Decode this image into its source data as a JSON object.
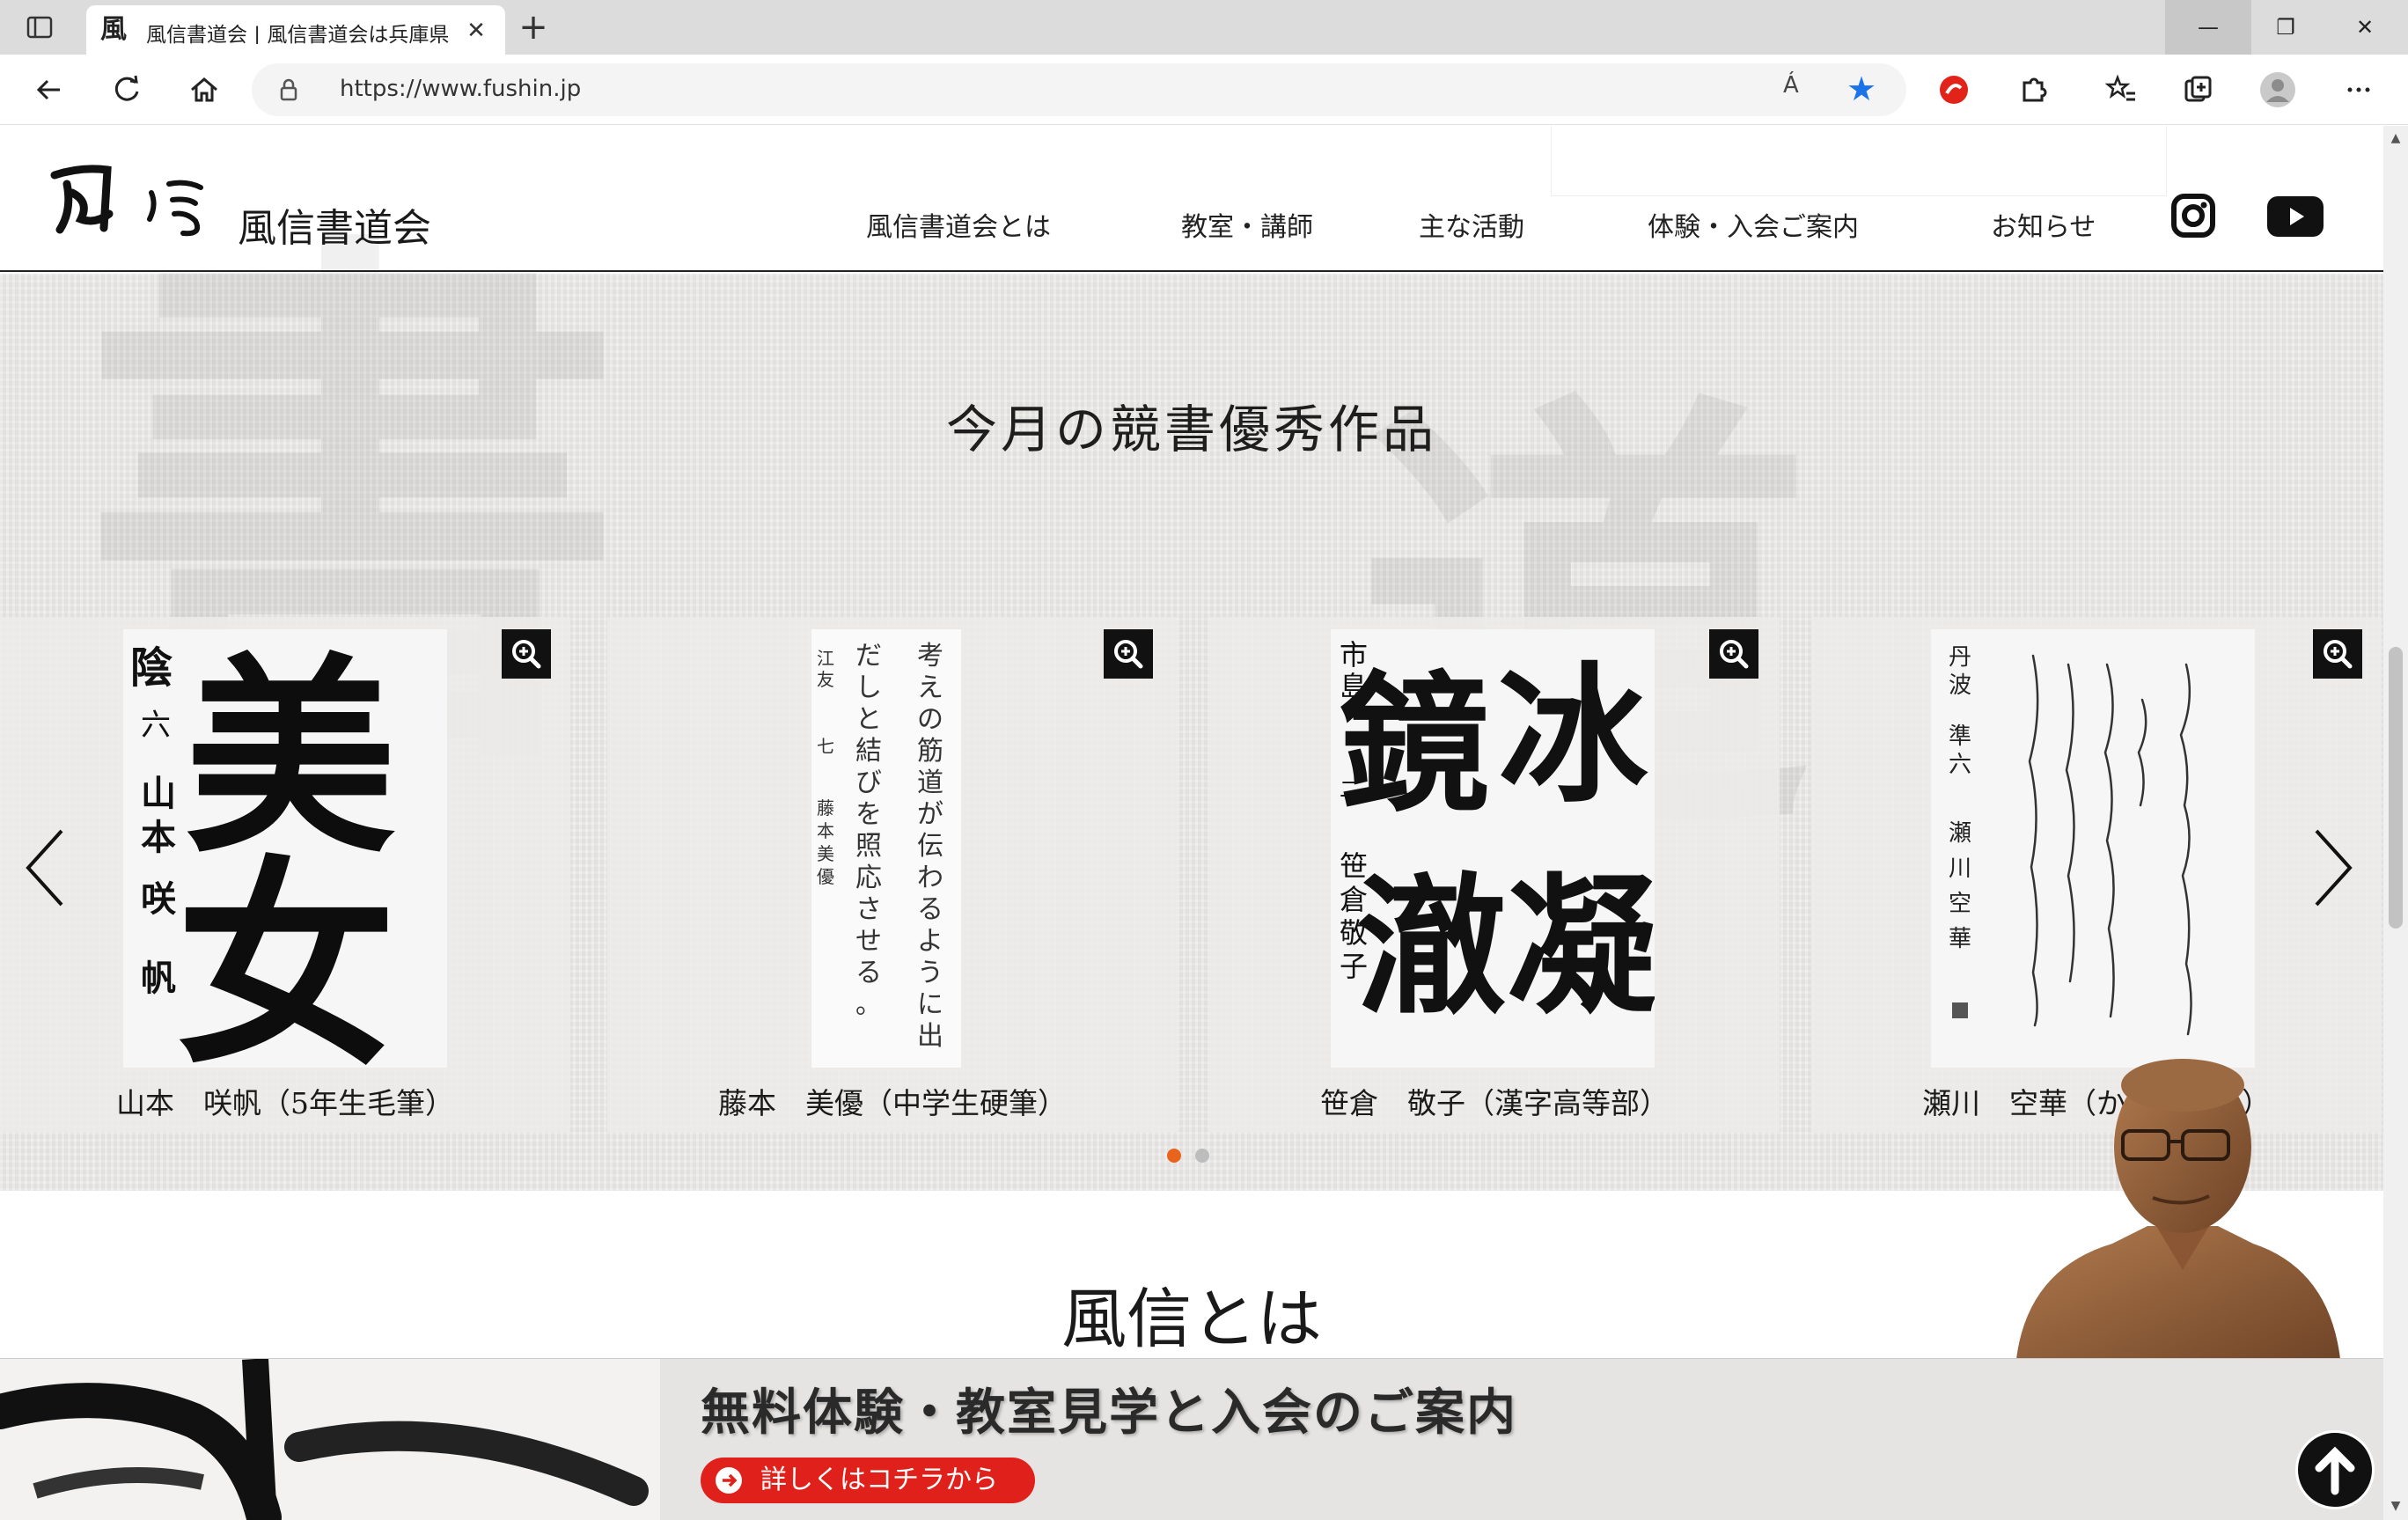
{
  "browser": {
    "tab_title": "風信書道会 | 風信書道会は兵庫県",
    "tab_favicon": "風",
    "url": "https://www.fushin.jp",
    "read_aloud": "Á"
  },
  "header": {
    "logo_text": "風信書道会",
    "logo_mark": "風 信",
    "nav": [
      "風信書道会とは",
      "教室・講師",
      "主な活動",
      "体験・入会ご案内",
      "お知らせ"
    ],
    "icons": [
      "instagram-icon",
      "youtube-icon"
    ]
  },
  "hero": {
    "title": "今月の競書優秀作品",
    "works": [
      {
        "caption": "山本　咲帆（5年生毛筆）",
        "main": "美女",
        "side": "陰 六 山本 咲帆"
      },
      {
        "caption": "藤本　美優（中学生硬筆）",
        "main": "考えの筋道が伝わるように出だしと結びを照応させる。",
        "side": "江友 七 藤本美優"
      },
      {
        "caption": "笹倉　敬子（漢字高等部）",
        "main": "鏡冰澈凝",
        "side": "市島 二 笹倉敬子"
      },
      {
        "caption": "瀬川　空華（かな専門部）",
        "main": "かな作品",
        "side": "丹波 準六 瀬川空華"
      }
    ],
    "pager": {
      "active": 0,
      "count": 2
    }
  },
  "about": {
    "title": "風信とは"
  },
  "banner": {
    "title": "無料体験・教室見学と入会のご案内",
    "button": "詳しくはコチラから"
  },
  "colors": {
    "accent": "#e8641c",
    "cta": "#e0201a",
    "star": "#1a73e8"
  }
}
